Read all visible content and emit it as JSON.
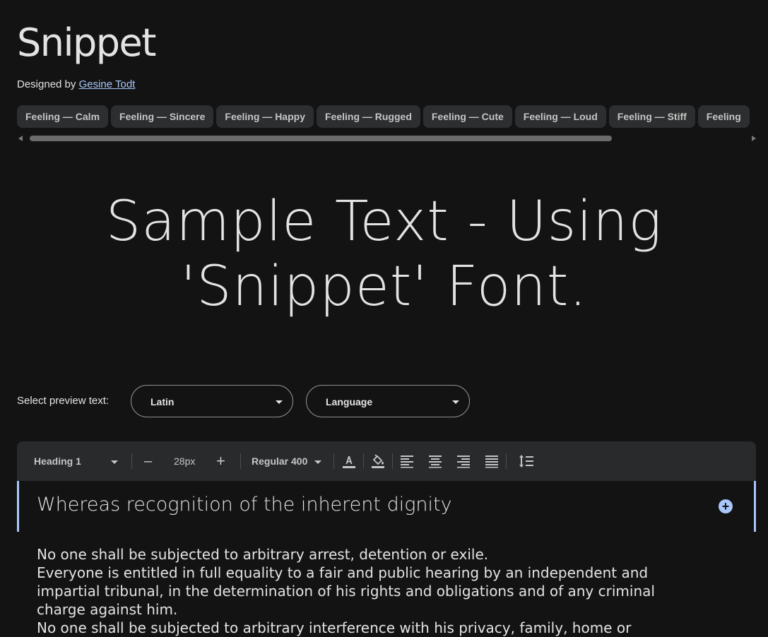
{
  "header": {
    "title": "Snippet",
    "designed_by_prefix": "Designed by ",
    "designer_name": "Gesine Todt"
  },
  "tags": [
    "Feeling — Calm",
    "Feeling — Sincere",
    "Feeling — Happy",
    "Feeling — Rugged",
    "Feeling — Cute",
    "Feeling — Loud",
    "Feeling — Stiff",
    "Feeling"
  ],
  "sample": {
    "line1": "Sample Text - Using",
    "line2": "'Snippet' Font."
  },
  "preview": {
    "label": "Select preview text:",
    "script_value": "Latin",
    "language_value": "Language"
  },
  "toolbar": {
    "style_value": "Heading 1",
    "decrease_label": "–",
    "size_value": "28px",
    "increase_label": "+",
    "weight_value": "Regular 400",
    "icons": [
      "text-color-icon",
      "highlight-color-icon",
      "align-left-icon",
      "align-center-icon",
      "align-right-icon",
      "align-justify-icon",
      "line-height-icon"
    ]
  },
  "editor": {
    "heading": "Whereas recognition of the inherent dignity",
    "paragraphs": [
      "No one shall be subjected to arbitrary arrest, detention or exile.",
      "Everyone is entitled in full equality to a fair and public hearing by an independent and impartial tribunal, in the determination of his rights and obligations and of any criminal charge against him.",
      "No one shall be subjected to arbitrary interference with his privacy, family, home or"
    ]
  },
  "colors": {
    "background": "#131314",
    "chip": "#2d2e30",
    "accent": "#a8c7fa",
    "toolbar": "#282a2c"
  }
}
